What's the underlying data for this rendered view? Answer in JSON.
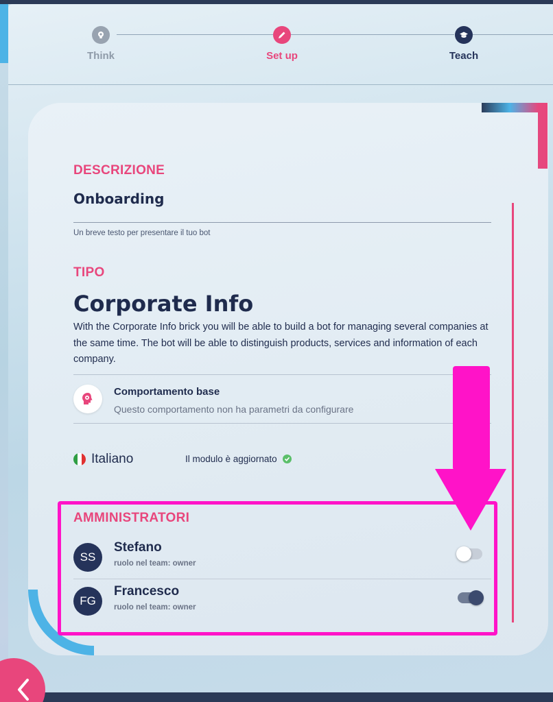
{
  "stepper": {
    "steps": [
      {
        "label": "Think",
        "icon": "lightbulb-icon",
        "state": "done",
        "color": "#8e9aa8"
      },
      {
        "label": "Set up",
        "icon": "pencil-icon",
        "state": "active",
        "color": "#e8467c"
      },
      {
        "label": "Teach",
        "icon": "graduation-cap-icon",
        "state": "upcoming",
        "color": "#25335a"
      }
    ]
  },
  "description": {
    "title": "DESCRIZIONE",
    "value": "Onboarding",
    "helper": "Un breve testo per presentare il tuo bot"
  },
  "type": {
    "title": "TIPO",
    "name": "Corporate Info",
    "description": "With the Corporate Info brick you will be able to build a bot for managing several companies at the same time. The bot will be able to distinguish products, services and information of each company."
  },
  "behavior": {
    "icon": "brain-gear-icon",
    "title": "Comportamento base",
    "subtitle": "Questo comportamento non ha parametri da configurare"
  },
  "language": {
    "flag": "italy-flag-icon",
    "label": "Italiano",
    "status": "Il modulo è aggiornato",
    "status_icon": "check-circle-icon"
  },
  "admins": {
    "title": "AMMINISTRATORI",
    "items": [
      {
        "initials": "SS",
        "name": "Stefano",
        "role": "ruolo nel team: owner",
        "enabled": false
      },
      {
        "initials": "FG",
        "name": "Francesco",
        "role": "ruolo nel team: owner",
        "enabled": true
      }
    ]
  },
  "colors": {
    "accent": "#e8467c",
    "navy": "#25335a",
    "highlight": "#ff13c8",
    "cyan": "#4db3e6",
    "success": "#5bbf6a"
  },
  "navigation": {
    "back_icon": "chevron-left-icon"
  }
}
